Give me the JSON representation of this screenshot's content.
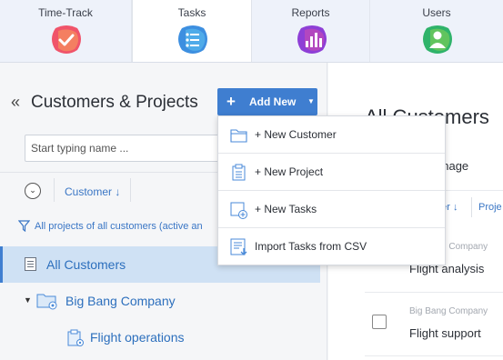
{
  "topnav": {
    "tabs": [
      {
        "label": "Time-Track",
        "icon": "checkmark-icon",
        "color": "#f0546a"
      },
      {
        "label": "Tasks",
        "icon": "list-icon",
        "color": "#3d8fe0"
      },
      {
        "label": "Reports",
        "icon": "bar-chart-icon",
        "color": "#8e3fd6"
      },
      {
        "label": "Users",
        "icon": "user-icon",
        "color": "#2fb36a"
      }
    ]
  },
  "left": {
    "collapse": "«",
    "title": "Customers & Projects",
    "add_new": "Add New",
    "search_placeholder": "Start typing name ...",
    "sort_label": "Customer ↓",
    "filter_text": "All projects of all customers (active an",
    "tree": {
      "all_customers": "All Customers",
      "company": "Big Bang Company",
      "project": "Flight operations"
    }
  },
  "menu": {
    "items": [
      {
        "label": "+ New Customer",
        "icon": "folder-icon"
      },
      {
        "label": "+ New Project",
        "icon": "clipboard-icon"
      },
      {
        "label": "+ New Tasks",
        "icon": "add-tasks-icon"
      },
      {
        "label": "Import Tasks from CSV",
        "icon": "import-csv-icon"
      }
    ]
  },
  "right": {
    "title": "All Customers",
    "manage": "anage",
    "col1": "ner ↓",
    "col2": "Proje",
    "rows": [
      {
        "company": "Big Bang Company",
        "task": "Flight analysis"
      },
      {
        "company": "Big Bang Company",
        "task": "Flight support"
      }
    ]
  },
  "colors": {
    "accent": "#3f7ed0",
    "link": "#2c6fbd",
    "selected_row": "#cfe1f4"
  }
}
